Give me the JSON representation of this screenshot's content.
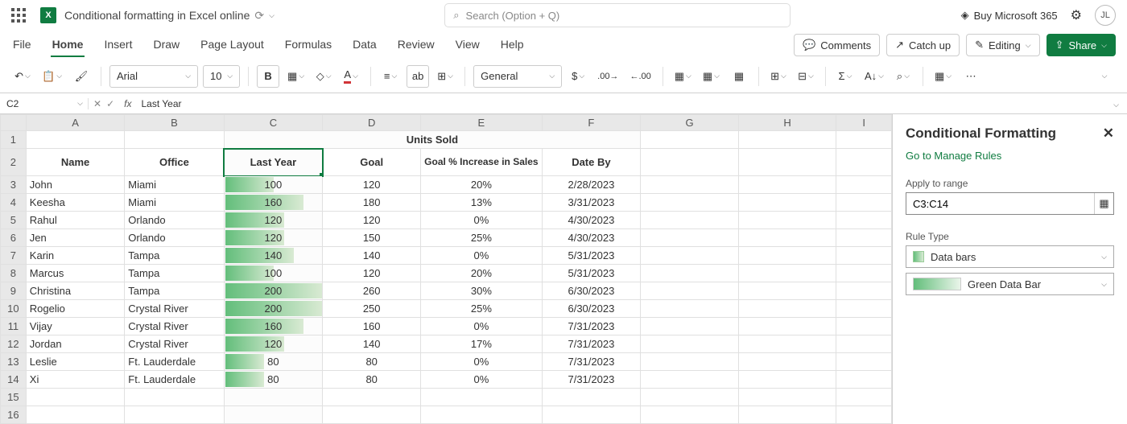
{
  "titlebar": {
    "doc_title": "Conditional formatting in Excel online",
    "search_placeholder": "Search (Option + Q)",
    "buy_label": "Buy Microsoft 365",
    "avatar_initials": "JL"
  },
  "tabs": [
    "File",
    "Home",
    "Insert",
    "Draw",
    "Page Layout",
    "Formulas",
    "Data",
    "Review",
    "View",
    "Help"
  ],
  "active_tab": 1,
  "actions": {
    "comments": "Comments",
    "catchup": "Catch up",
    "editing": "Editing",
    "share": "Share"
  },
  "ribbon": {
    "font_name": "Arial",
    "font_size": "10",
    "number_format": "General"
  },
  "formula_bar": {
    "cell_ref": "C2",
    "value": "Last Year"
  },
  "columns": [
    "A",
    "B",
    "C",
    "D",
    "E",
    "F",
    "G",
    "H",
    "I"
  ],
  "headers": {
    "units_sold_merge": "Units Sold",
    "row2": [
      "Name",
      "Office",
      "Last Year",
      "Goal",
      "Goal % Increase in Sales",
      "Date By"
    ]
  },
  "data_rows": [
    {
      "name": "John",
      "office": "Miami",
      "last": 100,
      "goal": 120,
      "pct": "20%",
      "date": "2/28/2023"
    },
    {
      "name": "Keesha",
      "office": "Miami",
      "last": 160,
      "goal": 180,
      "pct": "13%",
      "date": "3/31/2023"
    },
    {
      "name": "Rahul",
      "office": "Orlando",
      "last": 120,
      "goal": 120,
      "pct": "0%",
      "date": "4/30/2023"
    },
    {
      "name": "Jen",
      "office": "Orlando",
      "last": 120,
      "goal": 150,
      "pct": "25%",
      "date": "4/30/2023"
    },
    {
      "name": "Karin",
      "office": "Tampa",
      "last": 140,
      "goal": 140,
      "pct": "0%",
      "date": "5/31/2023"
    },
    {
      "name": "Marcus",
      "office": "Tampa",
      "last": 100,
      "goal": 120,
      "pct": "20%",
      "date": "5/31/2023"
    },
    {
      "name": "Christina",
      "office": "Tampa",
      "last": 200,
      "goal": 260,
      "pct": "30%",
      "date": "6/30/2023"
    },
    {
      "name": "Rogelio",
      "office": "Crystal River",
      "last": 200,
      "goal": 250,
      "pct": "25%",
      "date": "6/30/2023"
    },
    {
      "name": "Vijay",
      "office": "Crystal River",
      "last": 160,
      "goal": 160,
      "pct": "0%",
      "date": "7/31/2023"
    },
    {
      "name": "Jordan",
      "office": "Crystal River",
      "last": 120,
      "goal": 140,
      "pct": "17%",
      "date": "7/31/2023"
    },
    {
      "name": "Leslie",
      "office": "Ft. Lauderdale",
      "last": 80,
      "goal": 80,
      "pct": "0%",
      "date": "7/31/2023"
    },
    {
      "name": "Xi",
      "office": "Ft. Lauderdale",
      "last": 80,
      "goal": 80,
      "pct": "0%",
      "date": "7/31/2023"
    }
  ],
  "data_bar_max": 200,
  "pane": {
    "title": "Conditional Formatting",
    "link": "Go to Manage Rules",
    "apply_label": "Apply to range",
    "apply_value": "C3:C14",
    "rule_type_label": "Rule Type",
    "rule_type_value": "Data bars",
    "preset_value": "Green Data Bar"
  }
}
